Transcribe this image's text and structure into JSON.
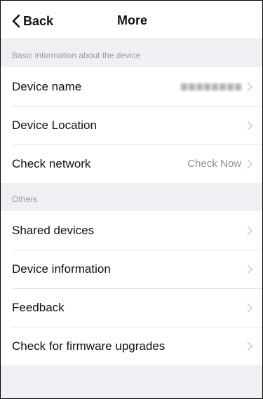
{
  "navbar": {
    "back_label": "Back",
    "title": "More"
  },
  "sections": {
    "basic": {
      "header": "Basic information about the device",
      "rows": [
        {
          "label": "Device name",
          "value": ""
        },
        {
          "label": "Device Location",
          "value": ""
        },
        {
          "label": "Check network",
          "value": "Check Now"
        }
      ]
    },
    "others": {
      "header": "Others",
      "rows": [
        {
          "label": "Shared devices"
        },
        {
          "label": "Device information"
        },
        {
          "label": "Feedback"
        },
        {
          "label": "Check for firmware upgrades"
        }
      ]
    }
  },
  "icons": {
    "back": "chevron-left-icon",
    "row": "chevron-right-icon"
  },
  "colors": {
    "background": "#efeff4",
    "separator": "#e5e5ea",
    "secondary_text": "#8e8e93"
  }
}
